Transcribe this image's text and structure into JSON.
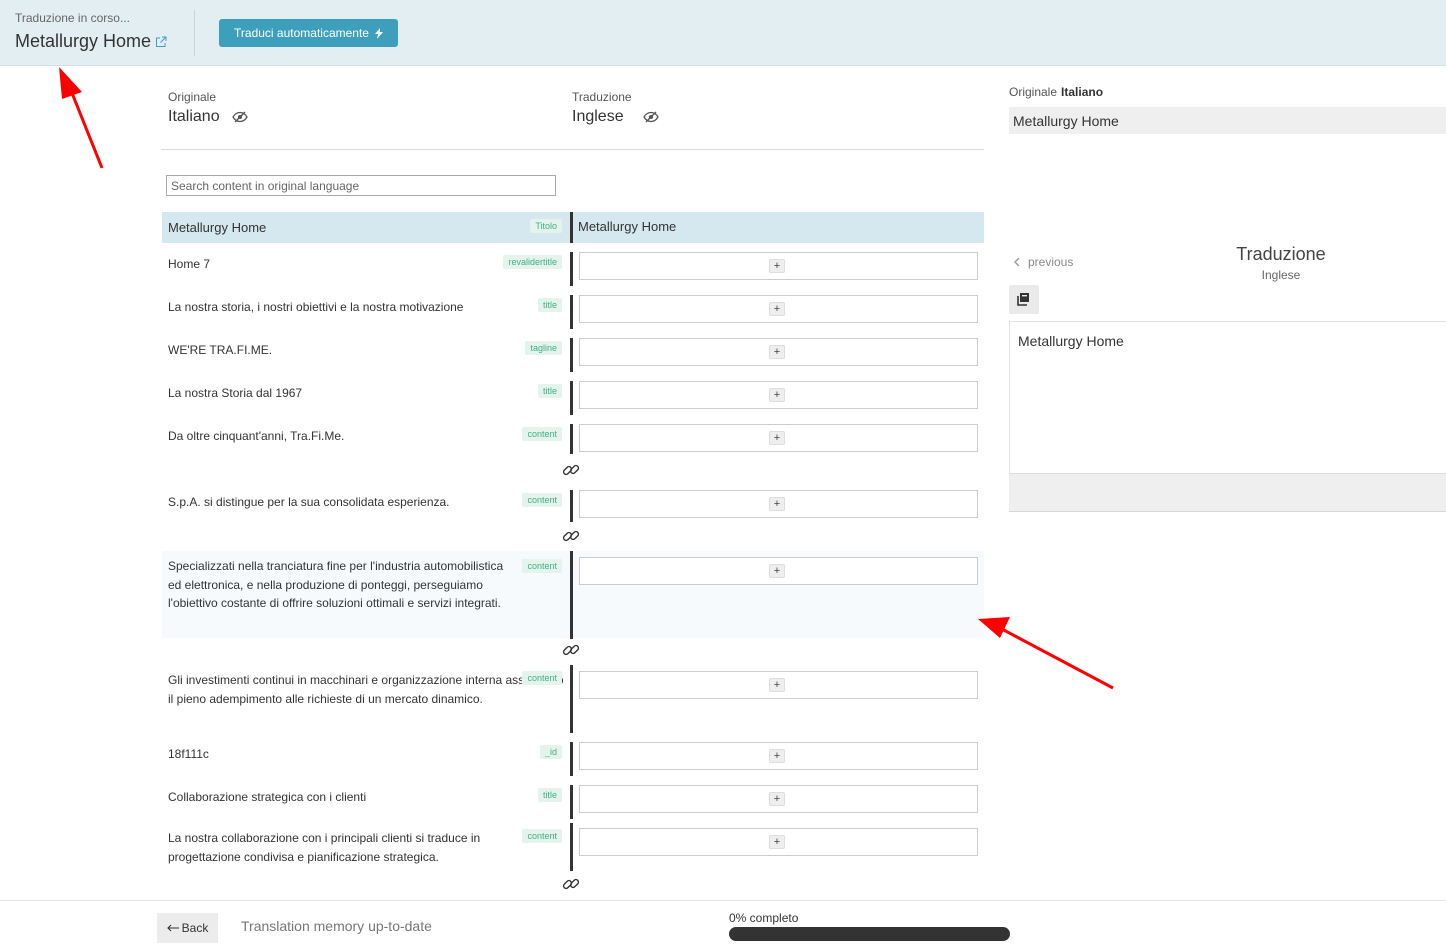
{
  "header": {
    "status": "Traduzione in corso...",
    "title": "Metallurgy Home",
    "auto_translate_label": "Traduci automaticamente"
  },
  "columns": {
    "original_caption": "Originale",
    "original_lang": "Italiano",
    "translation_caption": "Traduzione",
    "translation_lang": "Inglese"
  },
  "search": {
    "placeholder": "Search content in original language"
  },
  "rows": [
    {
      "source": "Metallurgy Home",
      "tag": "Titolo",
      "translation": "Metallurgy Home"
    },
    {
      "source": "Home 7",
      "tag": "revalidertitle"
    },
    {
      "source": "La nostra storia, i nostri obiettivi e la nostra motivazione",
      "tag": "title"
    },
    {
      "source": "WE'RE TRA.FI.ME.",
      "tag": "tagline"
    },
    {
      "source": "La nostra Storia dal 1967",
      "tag": "title"
    },
    {
      "source": "Da oltre cinquant'anni, Tra.Fi.Me.",
      "tag": "content"
    },
    {
      "source": "S.p.A. si distingue per la sua consolidata esperienza.",
      "tag": "content"
    },
    {
      "source": "Specializzati nella tranciatura fine per l'industria automobilistica ed elettronica, e nella produzione di ponteggi, perseguiamo l'obiettivo costante di offrire soluzioni ottimali e servizi integrati.",
      "tag": "content"
    },
    {
      "source": "Gli investimenti continui in macchinari e organizzazione interna assicurano il pieno adempimento alle richieste di un mercato dinamico.",
      "tag": "content"
    },
    {
      "source": "18f111c",
      "tag": "_id"
    },
    {
      "source": "Collaborazione strategica con i clienti",
      "tag": "title"
    },
    {
      "source": "La nostra collaborazione con i principali clienti si traduce in progettazione condivisa e pianificazione strategica.",
      "tag": "content"
    }
  ],
  "right_panel": {
    "original_caption": "Originale",
    "original_lang": "Italiano",
    "original_text": "Metallurgy Home",
    "previous_label": "previous",
    "translation_title": "Traduzione",
    "translation_lang": "Inglese",
    "translation_text": "Metallurgy Home"
  },
  "footer": {
    "back_label": "Back",
    "tm_status": "Translation memory up-to-date",
    "progress_label": "0% completo",
    "progress_percent": 0
  },
  "colors": {
    "accent": "#3d9fbc",
    "tag_bg": "#e4f3ec",
    "tag_text": "#3fae88",
    "arrow": "#ff0000"
  }
}
